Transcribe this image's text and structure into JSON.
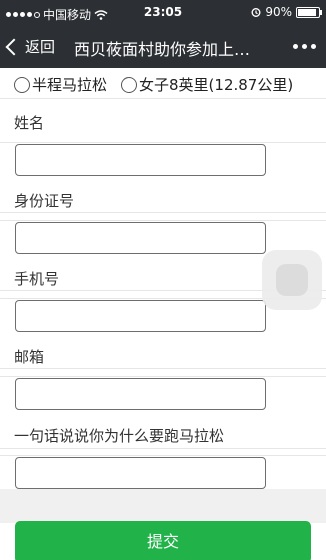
{
  "status_bar": {
    "carrier": "中国移动",
    "time": "23:05",
    "battery": "90%",
    "battery_level": 0.9
  },
  "nav": {
    "back_label": "返回",
    "title": "西贝莜面村助你参加上…"
  },
  "form": {
    "race_options": [
      "半程马拉松",
      "女子8英里(12.87公里)"
    ],
    "fields": [
      {
        "label": "姓名",
        "value": ""
      },
      {
        "label": "身份证号",
        "value": ""
      },
      {
        "label": "手机号",
        "value": ""
      },
      {
        "label": "邮箱",
        "value": ""
      },
      {
        "label": "一句话说说你为什么要跑马拉松",
        "value": ""
      }
    ],
    "submit_label": "提交"
  },
  "colors": {
    "bar_bg": "#2c2f33",
    "submit_green": "#21b34a"
  }
}
